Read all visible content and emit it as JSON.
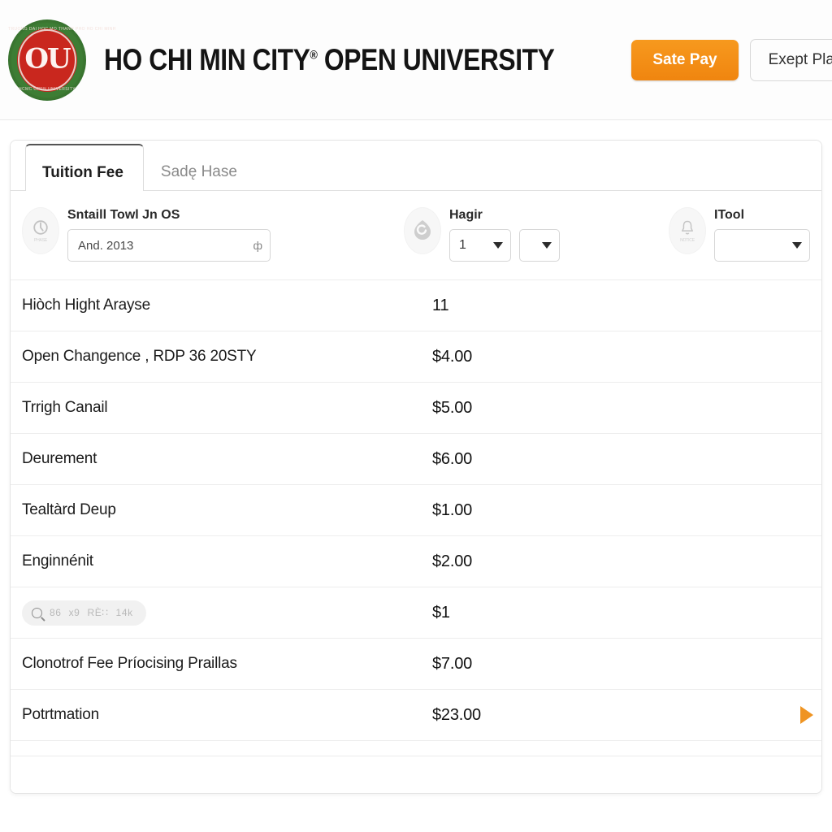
{
  "header": {
    "logo": {
      "icon": "university-seal-logo",
      "arc_top": "TRUONG DAI HOC MO THANH PHO HO CHI MINH",
      "arc_bottom": "HCMC OPEN UNIVERSITY",
      "monogram": "OU"
    },
    "title": "HO CHI MIN CITY",
    "title_sup": "®",
    "title_rest": " OPEN UNIVERSITY",
    "actions": {
      "pay_label": "Sate Pay",
      "plans_label": "Exept Plans",
      "pay_color": "#f29117"
    }
  },
  "tabs": [
    {
      "label": "Tuition Fee",
      "active": true
    },
    {
      "label": "Sadę Hase",
      "active": false
    }
  ],
  "filters": [
    {
      "icon": "clock-badge-icon",
      "icon_caption": "PHASE",
      "label": "Sntaill Towl Jn OS",
      "control": "text",
      "value": "And. 2013",
      "placeholder": "And. 2013",
      "field_icon": "currency-glyph"
    },
    {
      "icon": "swirl-badge-icon",
      "icon_caption": "",
      "label": "Hagir",
      "control": "selects",
      "select_primary": "1",
      "select_secondary": ""
    },
    {
      "icon": "bell-badge-icon",
      "icon_caption": "NOTICE",
      "label": "ITool",
      "control": "select",
      "select_primary": ""
    }
  ],
  "table": {
    "rows": [
      {
        "label": "Hiòch Hight Arayse",
        "value": "11",
        "type": "text"
      },
      {
        "label": "Open Changence , RDP 36 20STY",
        "value": "$4.00",
        "type": "text"
      },
      {
        "label": "Trrigh Canail",
        "value": "$5.00",
        "type": "text"
      },
      {
        "label": "Deurement",
        "value": "$6.00",
        "type": "text"
      },
      {
        "label": "Tealtàrd Deup",
        "value": "$1.00",
        "type": "text"
      },
      {
        "label": "Enginnénit",
        "value": "$2.00",
        "type": "text"
      },
      {
        "label": "",
        "value": "$1",
        "type": "search",
        "search": {
          "icon": "search-icon",
          "segments": [
            "86",
            "x9",
            "RÈ∷",
            "14k"
          ]
        }
      },
      {
        "label": "Clonotrof Fee Príocising Praillas",
        "value": "$7.00",
        "type": "text"
      },
      {
        "label": "Potrtmation",
        "value": "$23.00",
        "type": "text",
        "arrow": "play-arrow-icon"
      }
    ]
  }
}
